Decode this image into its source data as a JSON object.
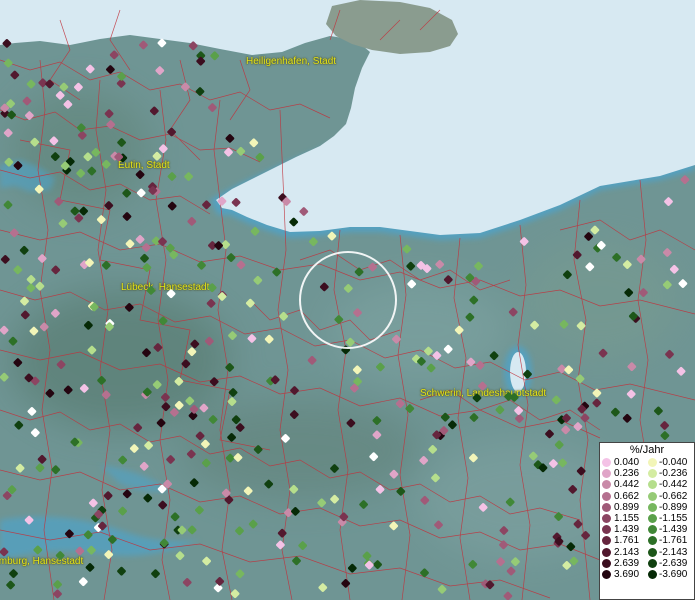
{
  "colors": {
    "land": "#6f9594",
    "water": "#d7e9f2",
    "coast": "#4fa3c8",
    "borders": "#c0323c",
    "label": "#e6e61a"
  },
  "cities": [
    {
      "name": "Heiligenhafen, Stadt"
    },
    {
      "name": "Eutin, Stadt"
    },
    {
      "name": "Lübeck, Hansestadt"
    },
    {
      "name": "Schwerin, Landeshauptstadt"
    },
    {
      "name": "Hamburg, Hansestadt"
    }
  ],
  "legend": {
    "title": "%/Jahr",
    "positive": [
      {
        "label": "0.040",
        "color": "#f4c2e6"
      },
      {
        "label": "0.236",
        "color": "#e0a5c8"
      },
      {
        "label": "0.442",
        "color": "#c98aa8"
      },
      {
        "label": "0.662",
        "color": "#b5708f"
      },
      {
        "label": "0.899",
        "color": "#a05a78"
      },
      {
        "label": "1.155",
        "color": "#8c4562"
      },
      {
        "label": "1.439",
        "color": "#7a3450"
      },
      {
        "label": "1.761",
        "color": "#66253e"
      },
      {
        "label": "2.143",
        "color": "#52182e"
      },
      {
        "label": "2.639",
        "color": "#3c0e1f"
      },
      {
        "label": "3.690",
        "color": "#240510"
      }
    ],
    "negative": [
      {
        "label": "-0.040",
        "color": "#f2f5b8"
      },
      {
        "label": "-0.236",
        "color": "#d4eca2"
      },
      {
        "label": "-0.442",
        "color": "#b5de8c"
      },
      {
        "label": "-0.662",
        "color": "#96cb76"
      },
      {
        "label": "-0.899",
        "color": "#77b75f"
      },
      {
        "label": "-1.155",
        "color": "#5aa04a"
      },
      {
        "label": "-1.439",
        "color": "#418837"
      },
      {
        "label": "-1.761",
        "color": "#2d7027"
      },
      {
        "label": "-2.143",
        "color": "#1d5719"
      },
      {
        "label": "-2.639",
        "color": "#10400f"
      },
      {
        "label": "-3.690",
        "color": "#062a06"
      }
    ]
  }
}
